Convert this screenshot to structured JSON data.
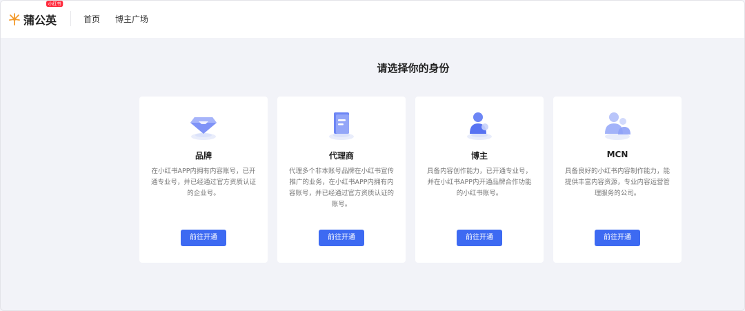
{
  "header": {
    "logo_text": "蒲公英",
    "logo_badge": "小红书",
    "nav": [
      "首页",
      "博主广场"
    ]
  },
  "page_title": "请选择你的身份",
  "cards": [
    {
      "icon": "diamond-icon",
      "title": "品牌",
      "description": "在小红书APP内拥有内容账号，已开通专业号，并已经通过官方资质认证的企业号。",
      "button": "前往开通"
    },
    {
      "icon": "document-icon",
      "title": "代理商",
      "description": "代理多个非本账号品牌在小红书宣传推广的业务，在小红书APP内拥有内容账号，并已经通过官方资质认证的账号。",
      "button": "前往开通"
    },
    {
      "icon": "user-icon",
      "title": "博主",
      "description": "具备内容创作能力，已开通专业号，并在小红书APP内开通品牌合作功能的小红书账号。",
      "button": "前往开通"
    },
    {
      "icon": "group-icon",
      "title": "MCN",
      "description": "具备良好的小红书内容制作能力，能提供丰富内容资源，专业内容运营管理服务的公司。",
      "button": "前往开通"
    }
  ],
  "colors": {
    "accent": "#3d6af2",
    "background": "#f2f3f8",
    "badge": "#ff2b3d",
    "logo": "#f39a2b"
  }
}
